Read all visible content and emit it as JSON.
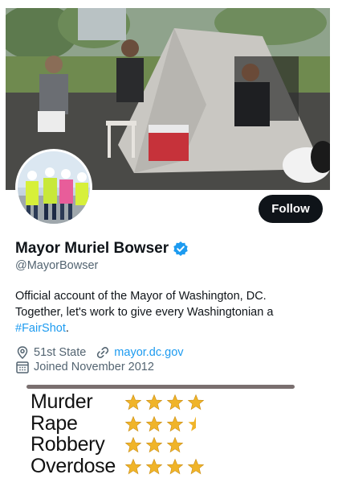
{
  "profile": {
    "display_name": "Mayor Muriel Bowser",
    "handle": "@MayorBowser",
    "follow_label": "Follow",
    "bio_text": "Official account of the Mayor of Washington, DC. Together, let's work to give every Washingtonian a",
    "bio_hashtag": "#FairShot",
    "bio_end": ".",
    "location": "51st State",
    "website": "mayor.dc.gov",
    "joined": "Joined November 2012"
  },
  "icons": {
    "verified": "verified-badge-icon",
    "location": "location-pin-icon",
    "link": "link-icon",
    "calendar": "calendar-icon",
    "star": "star-icon"
  },
  "colors": {
    "accent": "#1d9bf0",
    "follow_button": "#0f1419",
    "star": "#f0b429"
  },
  "ratings": [
    {
      "label": "Murder",
      "stars": 4
    },
    {
      "label": "Rape",
      "stars": 3.5
    },
    {
      "label": "Robbery",
      "stars": 3
    },
    {
      "label": "Overdose",
      "stars": 4
    }
  ]
}
